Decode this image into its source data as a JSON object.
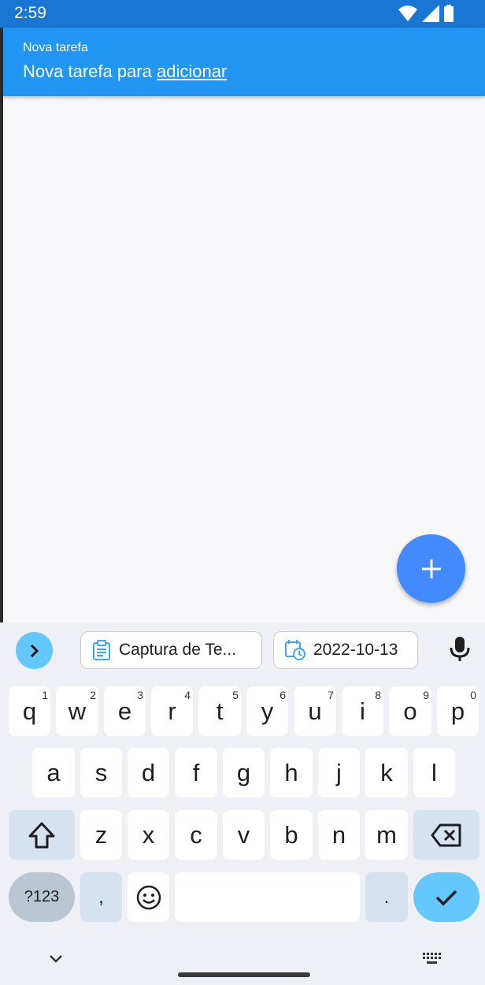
{
  "status_bar": {
    "time": "2:59"
  },
  "appbar": {
    "subtitle": "Nova tarefa",
    "title_prefix": "Nova tarefa para ",
    "title_link": "adicionar"
  },
  "fab": {
    "icon": "plus-icon"
  },
  "keyboard": {
    "suggestions": [
      {
        "label": "Captura de Te...",
        "icon": "clipboard-icon"
      },
      {
        "label": "2022-10-13",
        "icon": "calendar-clock-icon"
      }
    ],
    "row1": [
      {
        "char": "q",
        "hint": "1"
      },
      {
        "char": "w",
        "hint": "2"
      },
      {
        "char": "e",
        "hint": "3"
      },
      {
        "char": "r",
        "hint": "4"
      },
      {
        "char": "t",
        "hint": "5"
      },
      {
        "char": "y",
        "hint": "6"
      },
      {
        "char": "u",
        "hint": "7"
      },
      {
        "char": "i",
        "hint": "8"
      },
      {
        "char": "o",
        "hint": "9"
      },
      {
        "char": "p",
        "hint": "0"
      }
    ],
    "row2": [
      "a",
      "s",
      "d",
      "f",
      "g",
      "h",
      "j",
      "k",
      "l"
    ],
    "row3": [
      "z",
      "x",
      "c",
      "v",
      "b",
      "n",
      "m"
    ],
    "symbols_label": "?123",
    "comma": ",",
    "period": "."
  },
  "colors": {
    "status_bar": "#1976d2",
    "appbar": "#2196f3",
    "fab": "#448aff",
    "keyboard_accent": "#64c8ff"
  }
}
